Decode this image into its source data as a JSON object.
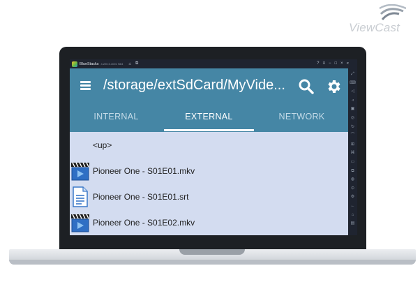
{
  "brand": {
    "logo_text": "ViewCast"
  },
  "window": {
    "app_name": "BlueStacks",
    "version": "4.220.0.4001 N64",
    "titlebar_icons": [
      "home-icon",
      "multi-instance-icon"
    ],
    "controls": [
      "help-icon",
      "menu-icon",
      "minimize-icon",
      "maximize-icon",
      "close-icon",
      "collapse-icon"
    ],
    "sidebar_icons": [
      "expand-icon",
      "keyboard-icon",
      "volume-up-icon",
      "volume-down-icon",
      "screen-record-icon",
      "camera-icon",
      "rotate-icon",
      "shake-icon",
      "gamepad-icon",
      "macro-icon",
      "folder-icon",
      "copy-icon",
      "eco-icon",
      "location-icon",
      "settings-icon",
      "back-icon",
      "home-icon",
      "recents-icon"
    ]
  },
  "toolbar": {
    "path": "/storage/extSdCard/MyVideos/Pioneer One",
    "colors": {
      "toolbar": "#4586a5",
      "list_bg": "#d3dcf0"
    }
  },
  "tabs": [
    {
      "label": "INTERNAL",
      "active": false
    },
    {
      "label": "EXTERNAL",
      "active": true
    },
    {
      "label": "NETWORK",
      "active": false
    }
  ],
  "files": [
    {
      "name": "<up>",
      "icon": "none"
    },
    {
      "name": "Pioneer One - S01E01.mkv",
      "icon": "video-file-icon"
    },
    {
      "name": "Pioneer One - S01E01.srt",
      "icon": "text-file-icon"
    },
    {
      "name": "Pioneer One - S01E02.mkv",
      "icon": "video-file-icon"
    }
  ]
}
